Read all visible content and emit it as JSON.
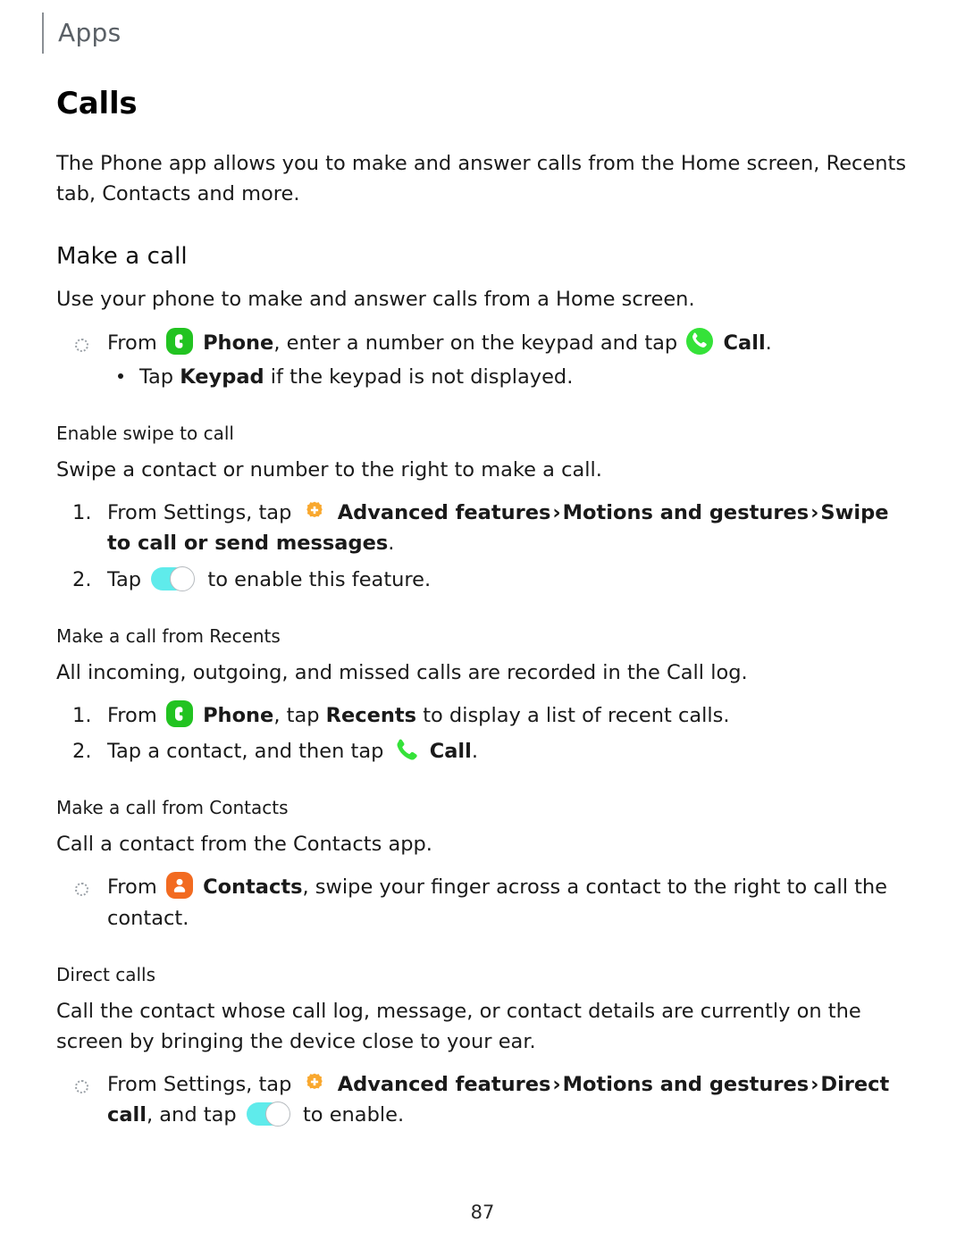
{
  "header": {
    "label": "Apps"
  },
  "page_title": "Calls",
  "intro": "The Phone app allows you to make and answer calls from the Home screen, Recents tab, Contacts and more.",
  "sections": {
    "make_a_call": {
      "heading": "Make a call",
      "intro": "Use your phone to make and answer calls from a Home screen.",
      "bullet": {
        "from": "From",
        "phone_label": "Phone",
        "mid": ", enter a number on the keypad and tap",
        "call_label": "Call",
        "period": ".",
        "sub_bullet_pre": "Tap",
        "sub_bullet_bold": "Keypad",
        "sub_bullet_post": "if the keypad is not displayed."
      }
    },
    "enable_swipe_to_call": {
      "heading": "Enable swipe to call",
      "intro": "Swipe a contact or number to the right to make a call.",
      "step1": {
        "num": "1.",
        "pre": "From Settings, tap",
        "path1": "Advanced features",
        "path2": "Motions and gestures",
        "path3": "Swipe to call or send messages",
        "period": ".",
        "chevron": "›"
      },
      "step2": {
        "num": "2.",
        "pre": "Tap",
        "post": "to enable this feature."
      }
    },
    "call_from_recents": {
      "heading": "Make a call from Recents",
      "intro": "All incoming, outgoing, and missed calls are recorded in the Call log.",
      "step1": {
        "num": "1.",
        "pre": "From",
        "phone_label": "Phone",
        "mid": ", tap",
        "recents_label": "Recents",
        "post": "to display a list of recent calls."
      },
      "step2": {
        "num": "2.",
        "pre": "Tap a contact, and then tap",
        "call_label": "Call",
        "period": "."
      }
    },
    "call_from_contacts": {
      "heading": "Make a call from Contacts",
      "intro": "Call a contact from the Contacts app.",
      "bullet": {
        "from": "From",
        "contacts_label": "Contacts",
        "post": ", swipe your finger across a contact to the right to call the contact."
      }
    },
    "direct_calls": {
      "heading": "Direct calls",
      "intro": "Call the contact whose call log, message, or contact details are currently on the screen by bringing the device close to your ear.",
      "bullet": {
        "pre": "From Settings, tap",
        "path1": "Advanced features",
        "path2": "Motions and gestures",
        "path3": "Direct call",
        "comma": ",",
        "chevron": "›",
        "and_tap": "and tap",
        "to_enable": "to enable."
      }
    }
  },
  "icons": {
    "phone_app": "phone-app-icon",
    "call_circle": "call-circle-icon",
    "call_handset": "call-handset-icon",
    "contacts_app": "contacts-app-icon",
    "advanced_features": "advanced-features-gear-icon",
    "toggle": "toggle-switch-on-icon"
  },
  "colors": {
    "phone_green": "#22C321",
    "call_green": "#35E239",
    "contacts_orange": "#F26B21",
    "gear_orange": "#F9A82E",
    "toggle_cyan": "#5FEBEB",
    "header_gray": "#5A6066"
  },
  "footer": {
    "page_number": "87"
  }
}
